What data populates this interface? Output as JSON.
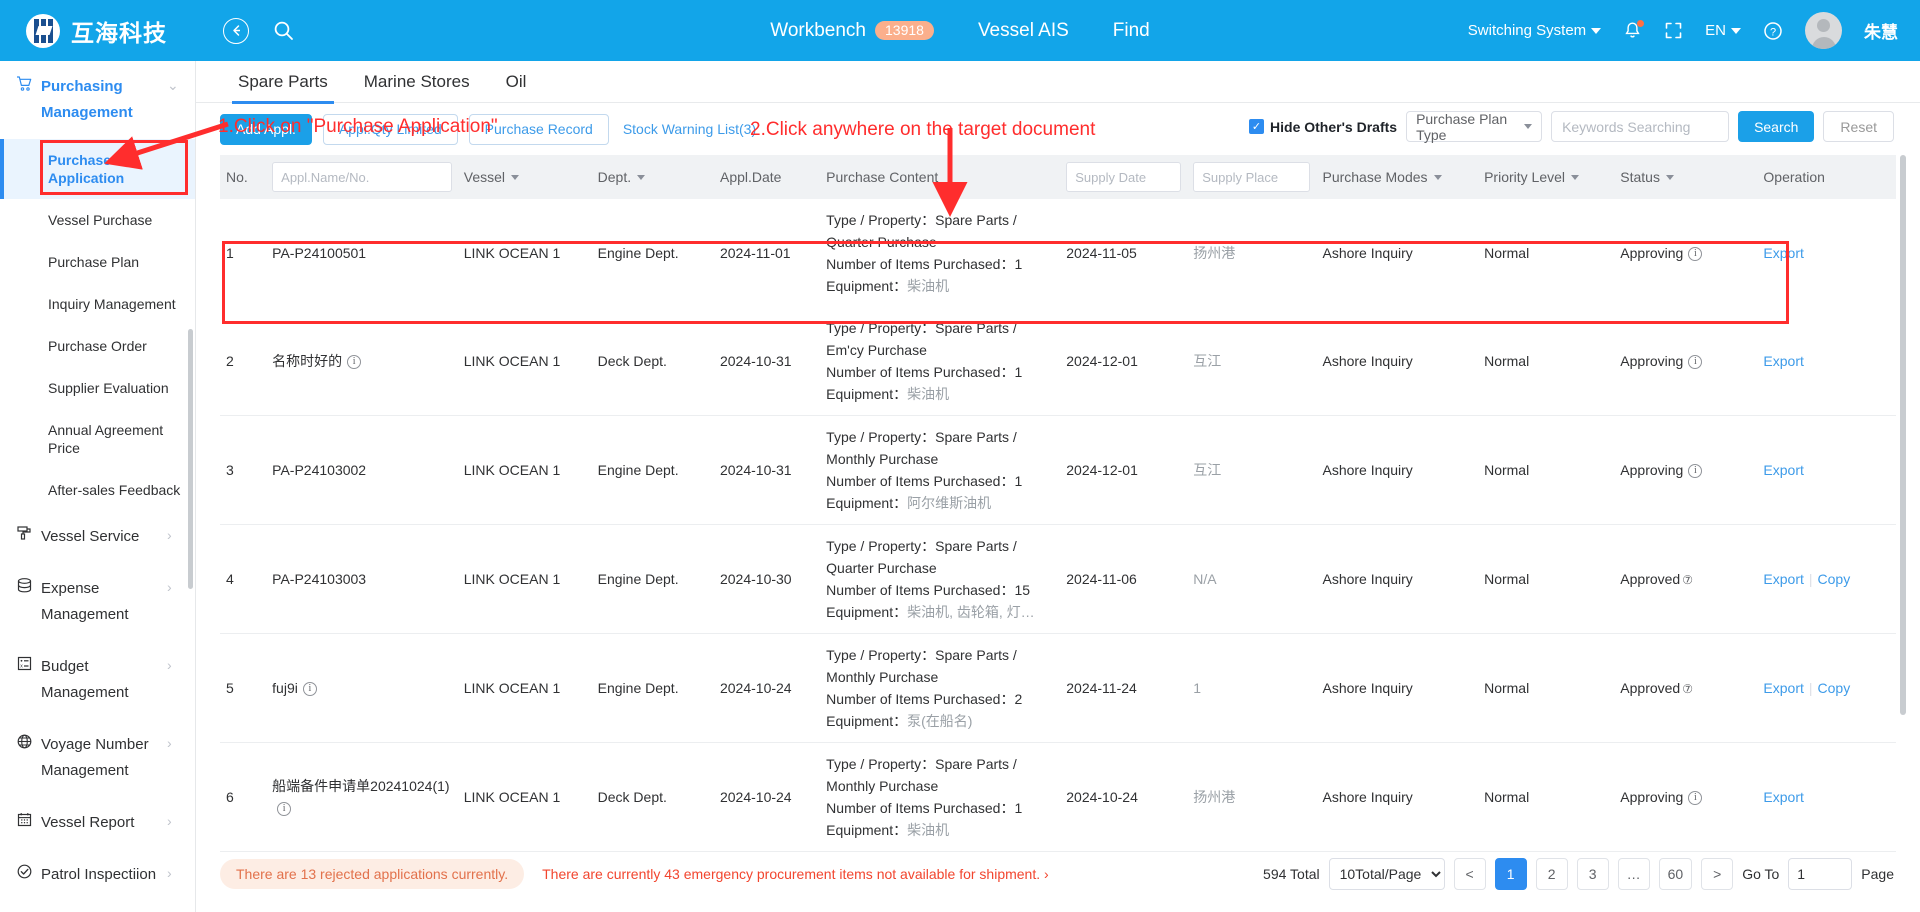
{
  "topbar": {
    "brand": "互海科技",
    "back_icon": "back-arrow-icon",
    "search_icon": "search-icon",
    "workbench_label": "Workbench",
    "workbench_count": "13918",
    "vessel_ais_label": "Vessel AIS",
    "find_label": "Find",
    "switching_system_label": "Switching System",
    "bell_icon": "bell-icon",
    "fullscreen_icon": "fullscreen-icon",
    "language_label": "EN",
    "help_icon": "help-icon",
    "user_name": "朱慧"
  },
  "sidebar": {
    "groups": [
      {
        "label": "Purchasing Management",
        "icon": "cart-icon",
        "active": true,
        "arrow": "chevron-down-icon"
      }
    ],
    "sub_items": [
      {
        "label": "Purchase Application",
        "selected": true
      },
      {
        "label": "Vessel Purchase",
        "selected": false
      },
      {
        "label": "Purchase Plan",
        "selected": false
      },
      {
        "label": "Inquiry Management",
        "selected": false
      },
      {
        "label": "Purchase Order",
        "selected": false
      },
      {
        "label": "Supplier Evaluation",
        "selected": false
      },
      {
        "label": "Annual Agreement Price",
        "selected": false
      },
      {
        "label": "After-sales Feedback",
        "selected": false
      }
    ],
    "other_groups": [
      {
        "label": "Vessel Service",
        "icon": "roller-icon",
        "arrow": "chevron-right-icon"
      },
      {
        "label": "Expense Management",
        "icon": "database-icon",
        "arrow": "chevron-right-icon"
      },
      {
        "label": "Budget Management",
        "icon": "calculator-icon",
        "arrow": "chevron-right-icon"
      },
      {
        "label": "Voyage Number Management",
        "icon": "globe-icon",
        "arrow": "chevron-right-icon"
      },
      {
        "label": "Vessel Report",
        "icon": "calendar-icon",
        "arrow": "chevron-right-icon"
      },
      {
        "label": "Patrol Inspectiion",
        "icon": "check-circle-icon",
        "arrow": "chevron-right-icon"
      }
    ]
  },
  "tabs": [
    {
      "label": "Spare Parts",
      "active": true
    },
    {
      "label": "Marine Stores",
      "active": false
    },
    {
      "label": "Oil",
      "active": false
    }
  ],
  "toolbar": {
    "add_appl": "Add Appl.",
    "appl_qty_limited": "Appl.Qty Limited",
    "purchase_record": "Purchase Record",
    "stock_warning_list": "Stock Warning List(3)",
    "hide_drafts_label": "Hide Other's Drafts",
    "hide_drafts_checked": true,
    "plan_type_value": "Purchase Plan Type",
    "keywords_placeholder": "Keywords Searching",
    "keywords_value": "",
    "search_label": "Search",
    "reset_label": "Reset"
  },
  "table": {
    "headers": {
      "no": "No.",
      "appl_name_placeholder": "Appl.Name/No.",
      "vessel": "Vessel",
      "dept": "Dept.",
      "appl_date": "Appl.Date",
      "purchase_content": "Purchase Content",
      "supply_date_placeholder": "Supply Date",
      "supply_place_placeholder": "Supply Place",
      "purchase_modes": "Purchase Modes",
      "priority_level": "Priority Level",
      "status": "Status",
      "operation": "Operation"
    },
    "content_labels": {
      "type_property": "Type / Property：",
      "number_items": "Number of Items Purchased：",
      "equipment": "Equipment："
    },
    "rows": [
      {
        "no": "1",
        "appl_name": "PA-P24100501",
        "has_info": false,
        "vessel": "LINK OCEAN 1",
        "dept": "Engine Dept.",
        "appl_date": "2024-11-01",
        "type_property": "Spare Parts / Quarter Purchase",
        "items": "1",
        "equipment": "柴油机",
        "supply_date": "2024-11-05",
        "supply_place": "扬州港",
        "purchase_modes": "Ashore Inquiry",
        "priority": "Normal",
        "status": "Approving",
        "status_icon": "info-icon",
        "ops": [
          "Export"
        ]
      },
      {
        "no": "2",
        "appl_name": "名称时好的",
        "has_info": true,
        "vessel": "LINK OCEAN 1",
        "dept": "Deck Dept.",
        "appl_date": "2024-10-31",
        "type_property": "Spare Parts / Em'cy Purchase",
        "items": "1",
        "equipment": "柴油机",
        "supply_date": "2024-12-01",
        "supply_place": "互江",
        "purchase_modes": "Ashore Inquiry",
        "priority": "Normal",
        "status": "Approving",
        "status_icon": "info-icon",
        "ops": [
          "Export"
        ]
      },
      {
        "no": "3",
        "appl_name": "PA-P24103002",
        "has_info": false,
        "vessel": "LINK OCEAN 1",
        "dept": "Engine Dept.",
        "appl_date": "2024-10-31",
        "type_property": "Spare Parts / Monthly Purchase",
        "items": "1",
        "equipment": "阿尔维斯油机",
        "supply_date": "2024-12-01",
        "supply_place": "互江",
        "purchase_modes": "Ashore Inquiry",
        "priority": "Normal",
        "status": "Approving",
        "status_icon": "info-icon",
        "ops": [
          "Export"
        ]
      },
      {
        "no": "4",
        "appl_name": "PA-P24103003",
        "has_info": false,
        "vessel": "LINK OCEAN 1",
        "dept": "Engine Dept.",
        "appl_date": "2024-10-30",
        "type_property": "Spare Parts / Quarter Purchase",
        "items": "15",
        "equipment": "柴油机, 齿轮箱, 灯…",
        "supply_date": "2024-11-06",
        "supply_place": "N/A",
        "purchase_modes": "Ashore Inquiry",
        "priority": "Normal",
        "status": "Approved",
        "status_icon": "question-icon",
        "ops": [
          "Export",
          "Copy"
        ]
      },
      {
        "no": "5",
        "appl_name": "fuj9i",
        "has_info": true,
        "vessel": "LINK OCEAN 1",
        "dept": "Engine Dept.",
        "appl_date": "2024-10-24",
        "type_property": "Spare Parts / Monthly Purchase",
        "items": "2",
        "equipment": "泵(在船名)",
        "supply_date": "2024-11-24",
        "supply_place": "1",
        "purchase_modes": "Ashore Inquiry",
        "priority": "Normal",
        "status": "Approved",
        "status_icon": "question-icon",
        "ops": [
          "Export",
          "Copy"
        ]
      },
      {
        "no": "6",
        "appl_name": "船端备件申请单20241024(1)",
        "has_info": true,
        "vessel": "LINK OCEAN 1",
        "dept": "Deck Dept.",
        "appl_date": "2024-10-24",
        "type_property": "Spare Parts / Monthly Purchase",
        "items": "1",
        "equipment": "柴油机",
        "supply_date": "2024-10-24",
        "supply_place": "扬州港",
        "purchase_modes": "Ashore Inquiry",
        "priority": "Normal",
        "status": "Approving",
        "status_icon": "info-icon",
        "ops": [
          "Export"
        ]
      }
    ]
  },
  "footer": {
    "rejected_notice": "There are 13 rejected applications currently.",
    "emergency_notice": "There are currently 43 emergency procurement items not available for shipment.",
    "emergency_arrow": "›",
    "total_label": "594 Total",
    "page_size": "10Total/Page",
    "prev": "<",
    "pages": [
      "1",
      "2",
      "3",
      "…",
      "60"
    ],
    "active_page": "1",
    "next": ">",
    "goto_label": "Go To",
    "goto_value": "1",
    "page_label": "Page"
  },
  "annotations": [
    {
      "text": "1.Click on \"Purchase Application\"",
      "color": "#FF2D2D"
    },
    {
      "text": "2.Click anywhere on the target document",
      "color": "#FF2D2D"
    }
  ]
}
